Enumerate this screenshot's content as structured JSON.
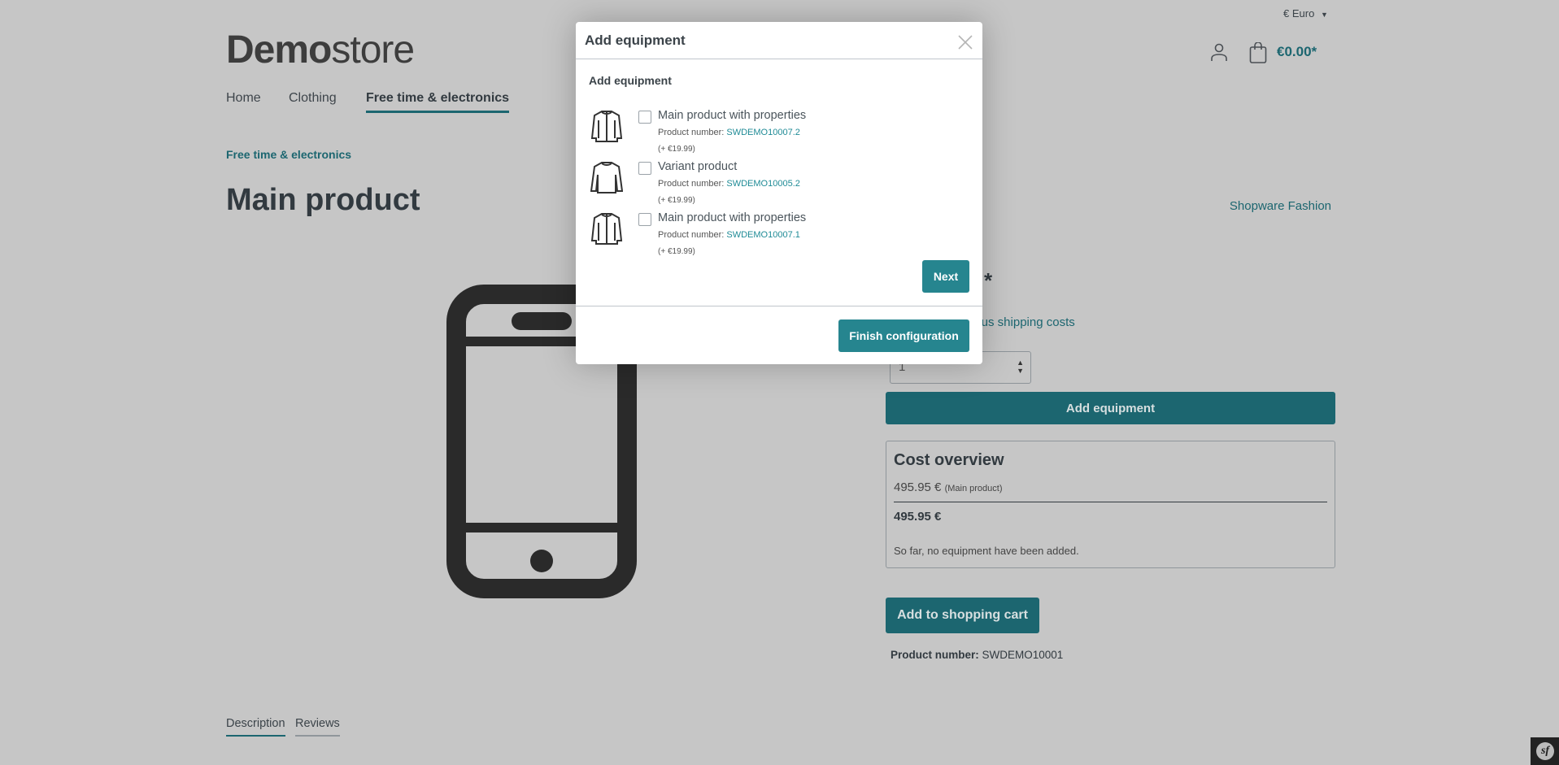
{
  "header": {
    "currency": "€ Euro",
    "logo_bold": "Demo",
    "logo_light": "store",
    "cart_total": "€0.00*",
    "nav": [
      {
        "label": "Home",
        "active": false
      },
      {
        "label": "Clothing",
        "active": false
      },
      {
        "label": "Free time & electronics",
        "active": true
      }
    ]
  },
  "product": {
    "breadcrumb": "Free time & electronics",
    "title": "Main product",
    "manufacturer": "Shopware Fashion",
    "price_suffix": "*",
    "shipping_text": "plus shipping costs",
    "quantity": "1",
    "add_equipment_label": "Add equipment",
    "cost_overview": {
      "title": "Cost overview",
      "main_price": "495.95 €",
      "main_note": "(Main product)",
      "total": "495.95 €",
      "empty_note": "So far, no equipment have been added."
    },
    "add_to_cart_label": "Add to shopping cart",
    "product_number_label": "Product number:",
    "product_number": "SWDEMO10001",
    "tabs": [
      {
        "label": "Description",
        "active": true
      },
      {
        "label": "Reviews",
        "active": false
      }
    ]
  },
  "modal": {
    "title": "Add equipment",
    "subtitle": "Add equipment",
    "items": [
      {
        "icon": "jacket-icon",
        "label": "Main product with properties",
        "number_label": "Product number:",
        "number": "SWDEMO10007.2",
        "price": "(+ €19.99)",
        "checked": false
      },
      {
        "icon": "sweater-icon",
        "label": "Variant product",
        "number_label": "Product number:",
        "number": "SWDEMO10005.2",
        "price": "(+ €19.99)",
        "checked": false
      },
      {
        "icon": "jacket-icon",
        "label": "Main product with properties",
        "number_label": "Product number:",
        "number": "SWDEMO10007.1",
        "price": "(+ €19.99)",
        "checked": false
      }
    ],
    "next_label": "Next",
    "finish_label": "Finish configuration"
  },
  "colors": {
    "accent": "#26858f",
    "accent_dimmed": "#1c6670",
    "overlay_bg": "#c6c6c6"
  }
}
